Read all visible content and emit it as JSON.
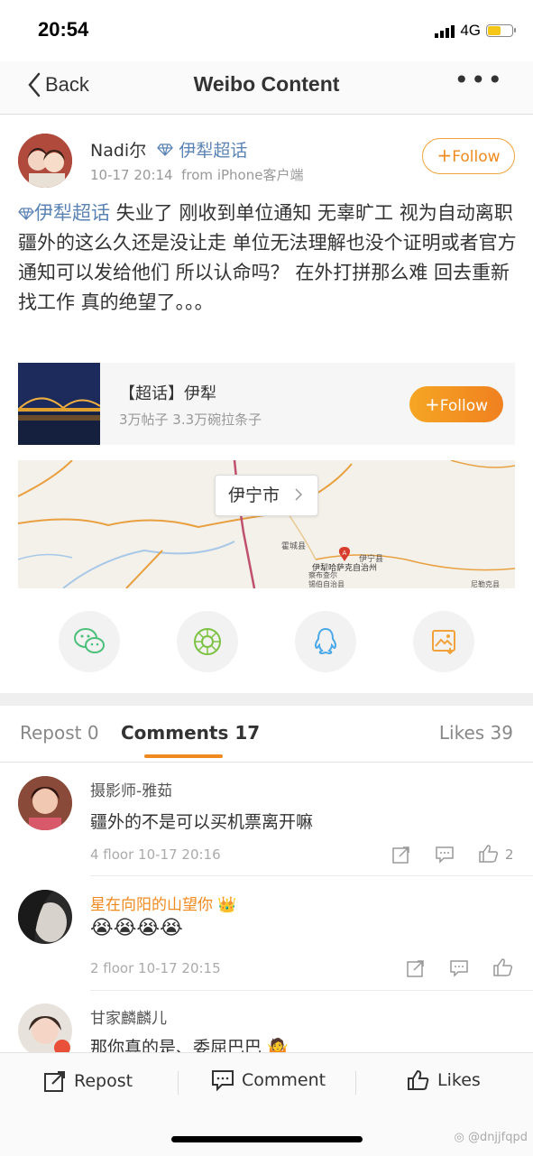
{
  "status": {
    "time": "20:54",
    "network": "4G"
  },
  "nav": {
    "back_label": "Back",
    "title": "Weibo Content",
    "more": "•••"
  },
  "post": {
    "username": "Nadi尔",
    "topic_tag": "伊犁超话",
    "date": "10-17 20:14",
    "source": "from iPhone客户端",
    "follow_label": "Follow",
    "text_topic": "伊犁超话",
    "text_body": " 失业了  刚收到单位通知   无辜旷工 视为自动离职   疆外的这么久还是没让走   单位无法理解也没个证明或者官方通知可以发给他们   所以认命吗？  在外打拼那么难   回去重新找工作   真的绝望了。。。"
  },
  "topic_card": {
    "title": "【超话】伊犁",
    "subtitle": "3万帖子 3.3万碗拉条子",
    "follow_label": "Follow"
  },
  "map": {
    "city_label": "伊宁市",
    "places": [
      "霍城县",
      "伊宁县",
      "伊犁哈萨克自治州",
      "察布查尔",
      "锡伯自治县",
      "尼勒克县"
    ]
  },
  "share": [
    "wechat-icon",
    "moments-icon",
    "qq-icon",
    "save-image-icon"
  ],
  "tabs": {
    "repost": "Repost 0",
    "comments": "Comments 17",
    "likes": "Likes 39"
  },
  "comments": [
    {
      "name": "摄影师-雅茹",
      "text": "疆外的不是可以买机票离开嘛",
      "meta": "4 floor 10-17 20:16",
      "likes": "2"
    },
    {
      "name": "星在向阳的山望你",
      "text": "😭😭😭😭",
      "meta": "2 floor 10-17 20:15",
      "likes": ""
    },
    {
      "name": "甘家麟麟儿",
      "text": "那你真的是、委屈巴巴",
      "meta": "",
      "likes": ""
    }
  ],
  "bottom_bar": {
    "repost": "Repost",
    "comment": "Comment",
    "likes": "Likes"
  },
  "watermark": "@dnjjfqpd",
  "colors": {
    "accent": "#f08a1e",
    "link": "#5b84b5"
  }
}
